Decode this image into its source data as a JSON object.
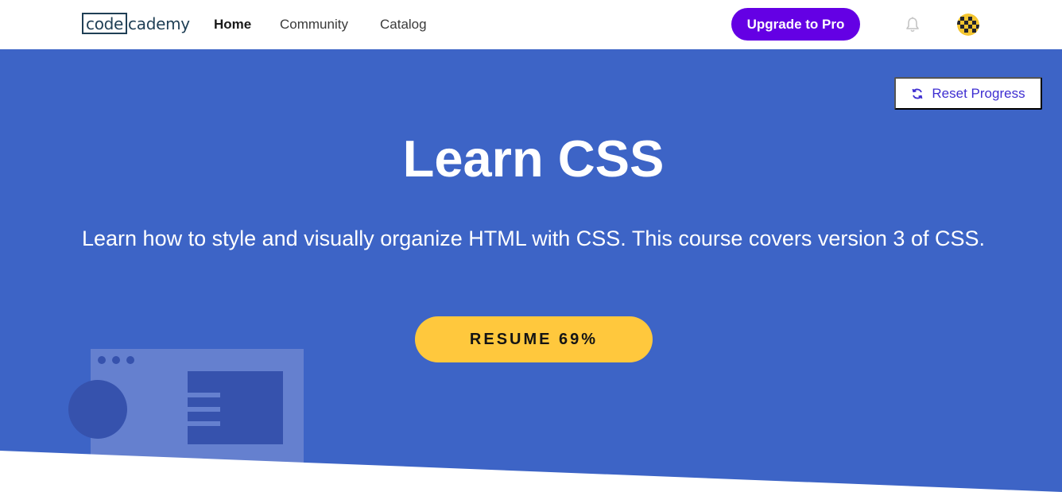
{
  "header": {
    "logo": {
      "part1": "code",
      "part2": "cademy"
    },
    "nav": [
      {
        "label": "Home",
        "active": true
      },
      {
        "label": "Community",
        "active": false
      },
      {
        "label": "Catalog",
        "active": false
      }
    ],
    "upgrade_label": "Upgrade to Pro",
    "notification_icon": "bell-icon",
    "avatar_icon": "user-avatar"
  },
  "hero": {
    "reset_label": "Reset Progress",
    "reset_icon": "refresh-icon",
    "title": "Learn CSS",
    "description": "Learn how to style and visually organize HTML with CSS. This course covers version 3 of CSS.",
    "resume_label": "RESUME 69%"
  },
  "colors": {
    "brand_purple": "#6400e4",
    "hero_blue": "#3d64c6",
    "resume_yellow": "#ffc83d",
    "reset_text": "#3e2ed1"
  }
}
